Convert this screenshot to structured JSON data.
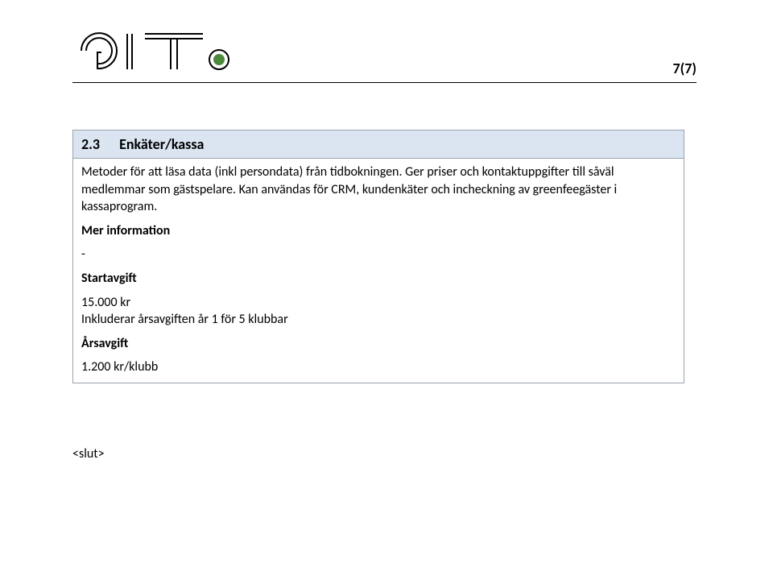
{
  "header": {
    "logo_text": "GIT",
    "page_number": "7(7)"
  },
  "box": {
    "section_number": "2.3",
    "section_title": "Enkäter/kassa",
    "body_text": "Metoder för att läsa data (inkl persondata) från tidbokningen. Ger priser och kontaktuppgifter till såväl medlemmar som gästspelare. Kan användas för CRM, kundenkäter och incheckning av greenfeegäster i kassaprogram.",
    "more_info_label": "Mer information",
    "more_info_value": "-",
    "start_fee_label": "Startavgift",
    "start_fee_amount": "15.000 kr",
    "start_fee_includes": "Inkluderar årsavgiften år 1 för 5 klubbar",
    "annual_fee_label": "Årsavgift",
    "annual_fee_amount": "1.200 kr/klubb"
  },
  "footer": {
    "end_marker": "<slut>"
  }
}
